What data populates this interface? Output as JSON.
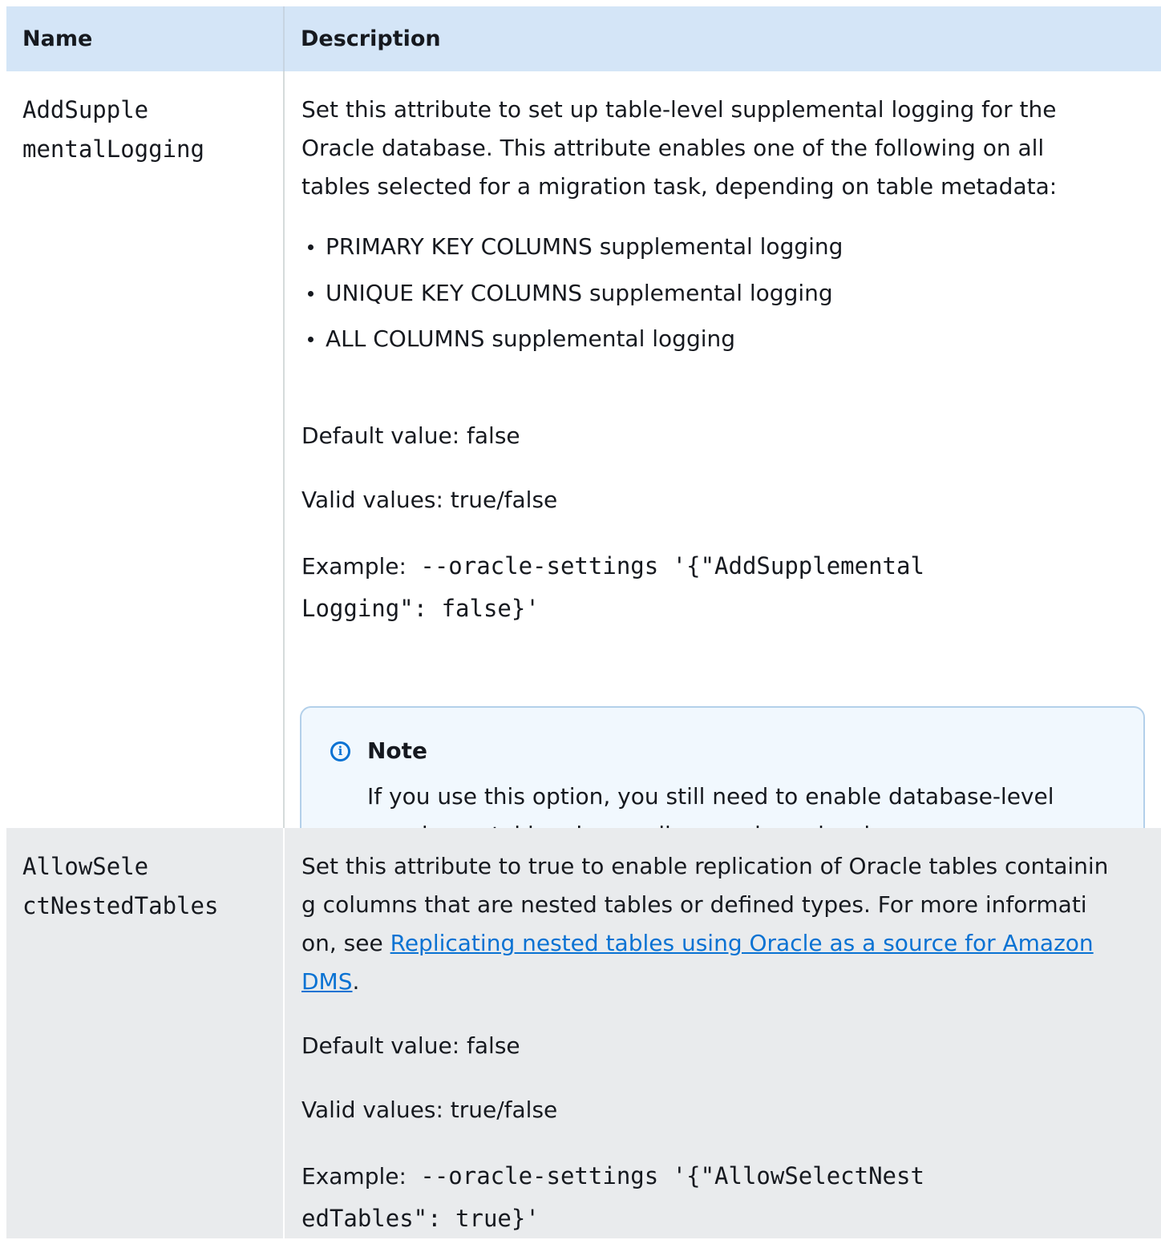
{
  "table": {
    "headers": {
      "name": "Name",
      "description": "Description"
    },
    "rows": [
      {
        "name_lines": [
          "AddSupple",
          "mentalLogging"
        ],
        "intro_lines": [
          "Set this attribute to set up table-level supplemental logging for the",
          "Oracle database. This attribute enables one of the following on all",
          "tables selected for a migration task, depending on table metadata:"
        ],
        "bullets": [
          "PRIMARY KEY COLUMNS supplemental logging",
          "UNIQUE KEY COLUMNS supplemental logging",
          "ALL COLUMNS supplemental logging"
        ],
        "default_value": "Default value: false",
        "valid_values": "Valid values: true/false",
        "example_label": "Example:",
        "example_code_lines": [
          " --oracle-settings '{\"AddSupplemental",
          "Logging\": false}'"
        ],
        "note": {
          "icon": "info-icon",
          "title": "Note",
          "body_lines": [
            "If you use this option, you still need to enable database-level",
            "supplemental logging as discussed previously."
          ]
        }
      },
      {
        "name_lines": [
          "AllowSele",
          "ctNestedTables"
        ],
        "intro_lines": [
          "Set this attribute to true to enable replication of Oracle tables containin",
          "g columns that are nested tables or defined types. For more informati"
        ],
        "intro_line3_prefix": "on, see ",
        "link_line1": "Replicating nested tables using Oracle as a source for Amazon",
        "link_line2": "DMS",
        "intro_suffix": ".",
        "default_value": "Default value: false",
        "valid_values": "Valid values: true/false",
        "example_label": "Example:",
        "example_code_lines": [
          " --oracle-settings '{\"AllowSelectNest",
          "edTables\": true}'"
        ]
      }
    ]
  },
  "colors": {
    "header_bg": "#d4e5f7",
    "row2_bg": "#e9ebed",
    "note_bg": "#f1f8fe",
    "note_border": "#b3d0ea",
    "link": "#0972d3"
  }
}
